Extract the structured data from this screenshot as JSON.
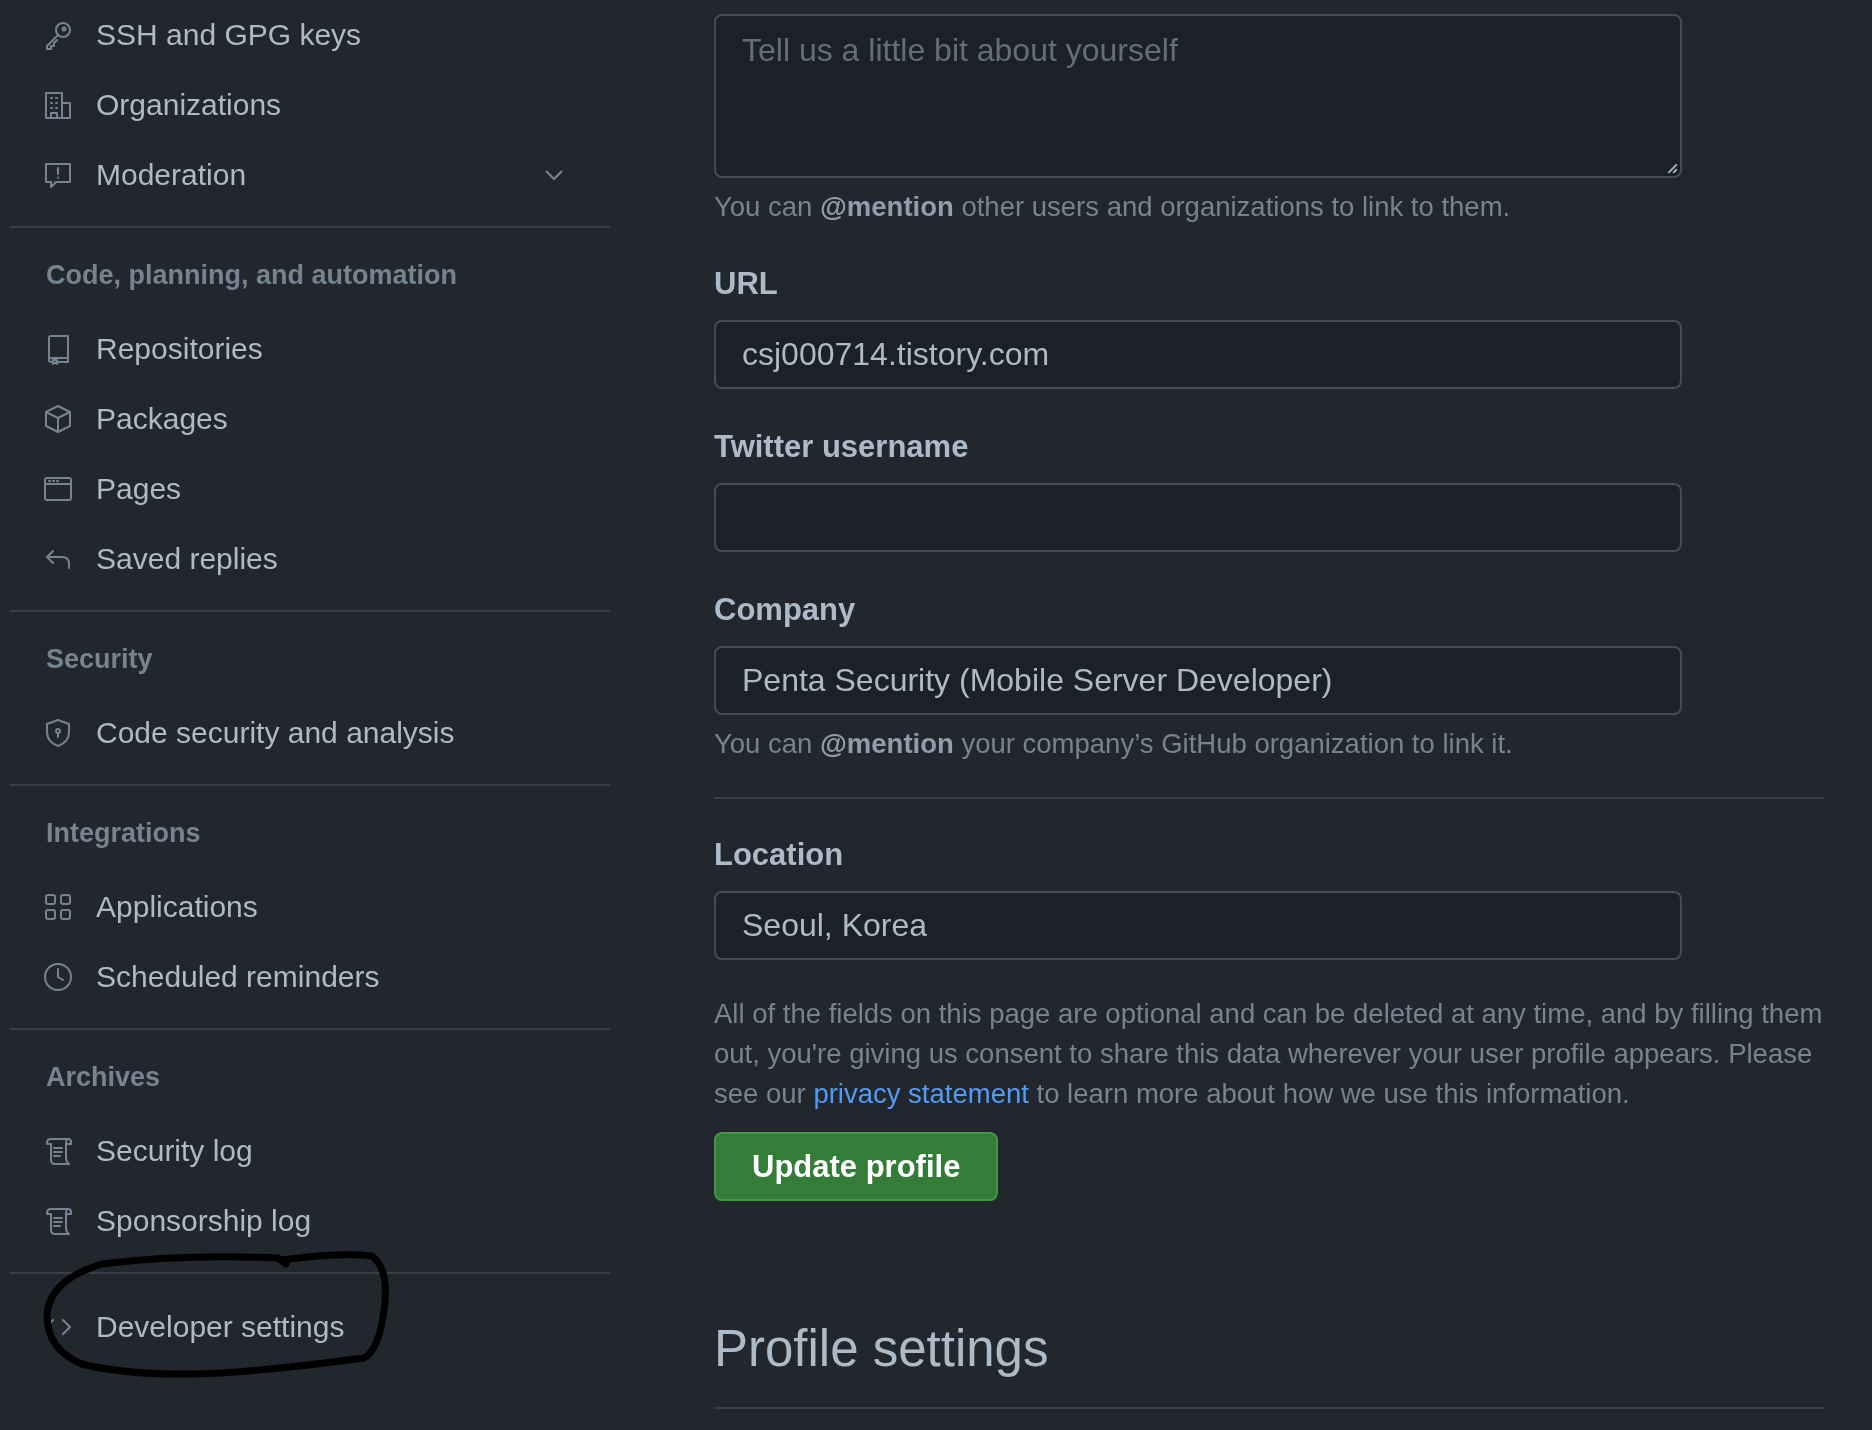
{
  "sidebar": {
    "groups": [
      {
        "items": [
          {
            "label": "SSH and GPG keys",
            "kind": "key",
            "selected": false
          },
          {
            "label": "Organizations",
            "kind": "building",
            "selected": false
          },
          {
            "label": "Moderation",
            "kind": "report",
            "selected": false,
            "expanded": false
          }
        ]
      },
      {
        "heading": "Code, planning, and automation",
        "items": [
          {
            "label": "Repositories",
            "kind": "repo",
            "selected": false
          },
          {
            "label": "Packages",
            "kind": "package",
            "selected": false
          },
          {
            "label": "Pages",
            "kind": "browser",
            "selected": false
          },
          {
            "label": "Saved replies",
            "kind": "reply",
            "selected": false
          }
        ]
      },
      {
        "heading": "Security",
        "items": [
          {
            "label": "Code security and analysis",
            "kind": "shield",
            "selected": false
          }
        ]
      },
      {
        "heading": "Integrations",
        "items": [
          {
            "label": "Applications",
            "kind": "apps",
            "selected": false
          },
          {
            "label": "Scheduled reminders",
            "kind": "clock",
            "selected": false
          }
        ]
      },
      {
        "heading": "Archives",
        "items": [
          {
            "label": "Security log",
            "kind": "log",
            "selected": false
          },
          {
            "label": "Sponsorship log",
            "kind": "log",
            "selected": false
          }
        ]
      },
      {
        "items": [
          {
            "label": "Developer settings",
            "kind": "code",
            "selected": false
          }
        ]
      }
    ]
  },
  "form": {
    "fields": [
      {
        "kind": "textarea",
        "placeholder": "Tell us a little bit about yourself",
        "hint": "You can **@mention** other users and organizations to link to them."
      },
      {
        "kind": "input",
        "label": "URL",
        "value": "csj000714.tistory.com"
      },
      {
        "kind": "input",
        "label": "Twitter username"
      },
      {
        "kind": "input",
        "label": "Company",
        "value": "Penta Security (Mobile Server Developer)",
        "hint": "You can **@mention** your company’s GitHub organization to link it."
      },
      {
        "kind": "divider"
      },
      {
        "kind": "input",
        "label": "Location",
        "value": "Seoul, Korea"
      }
    ],
    "notice": {
      "before": "All of the fields on this page are optional and can be deleted at any time, and by filling them out, you're giving us consent to share this data wherever your user profile appears. Please see our ",
      "link": "privacy statement",
      "after": " to learn more about how we use this information."
    },
    "submit": "Update profile"
  },
  "next_section": {
    "title": "Profile settings"
  }
}
